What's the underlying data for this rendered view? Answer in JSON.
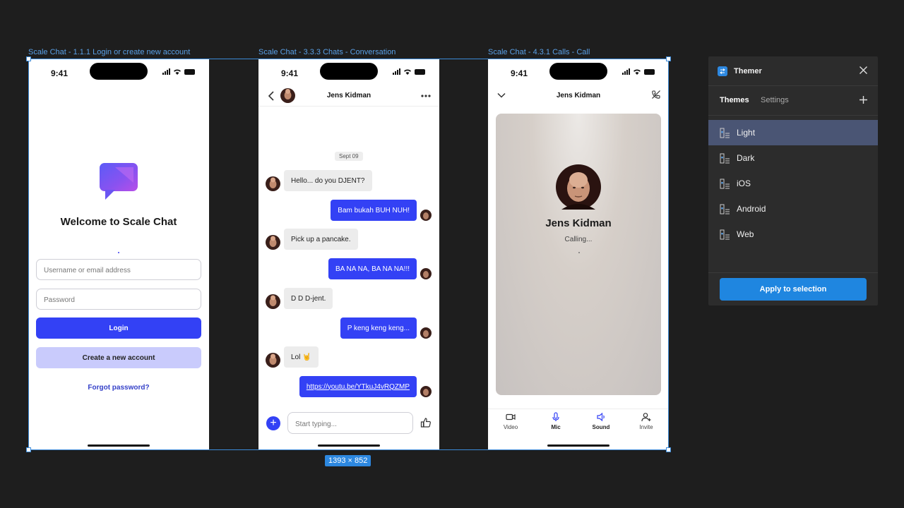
{
  "frames": {
    "login_label": "Scale Chat - 1.1.1 Login or create new account",
    "chat_label": "Scale Chat - 3.3.3 Chats - Conversation",
    "call_label": "Scale Chat - 4.3.1 Calls - Call",
    "selection_size": "1393 × 852"
  },
  "status_bar": {
    "time": "9:41"
  },
  "login": {
    "title": "Welcome to Scale Chat",
    "username_placeholder": "Username or email address",
    "password_placeholder": "Password",
    "login_button": "Login",
    "create_account_button": "Create a new account",
    "forgot_password": "Forgot password?"
  },
  "chat": {
    "contact_name": "Jens Kidman",
    "date_separator": "Sept 09",
    "messages": [
      {
        "direction": "in",
        "text": "Hello... do you DJENT?"
      },
      {
        "direction": "out",
        "text": "Bam bukah BUH NUH!"
      },
      {
        "direction": "in",
        "text": "Pick up a pancake."
      },
      {
        "direction": "out",
        "text": "BA NA NA, BA NA NA!!!"
      },
      {
        "direction": "in",
        "text": "D D D-jent."
      },
      {
        "direction": "out",
        "text": "P keng keng keng..."
      },
      {
        "direction": "in",
        "text": "Lol 🤘"
      },
      {
        "direction": "out",
        "text": "https://youtu.be/YTkuJ4vRQZMP",
        "link": true
      }
    ],
    "input_placeholder": "Start typing..."
  },
  "call": {
    "contact_name": "Jens Kidman",
    "status": "Calling...",
    "actions": [
      {
        "label": "Video",
        "icon": "video-icon",
        "active": false
      },
      {
        "label": "Mic",
        "icon": "mic-icon",
        "active": true
      },
      {
        "label": "Sound",
        "icon": "speaker-icon",
        "active": true
      },
      {
        "label": "Invite",
        "icon": "add-person-icon",
        "active": false
      }
    ]
  },
  "themer": {
    "title": "Themer",
    "tabs": [
      "Themes",
      "Settings"
    ],
    "themes": [
      {
        "label": "Light",
        "selected": true
      },
      {
        "label": "Dark",
        "selected": false
      },
      {
        "label": "iOS",
        "selected": false
      },
      {
        "label": "Android",
        "selected": false
      },
      {
        "label": "Web",
        "selected": false
      }
    ],
    "apply_button": "Apply to selection"
  },
  "colors": {
    "canvas": "#1e1e1e",
    "primary": "#3341f5",
    "secondary": "#c9cbfc",
    "selection": "#3c8ad8",
    "panel": "#2c2c2c",
    "panel_selected": "#4a5574",
    "apply": "#1f86e0"
  }
}
